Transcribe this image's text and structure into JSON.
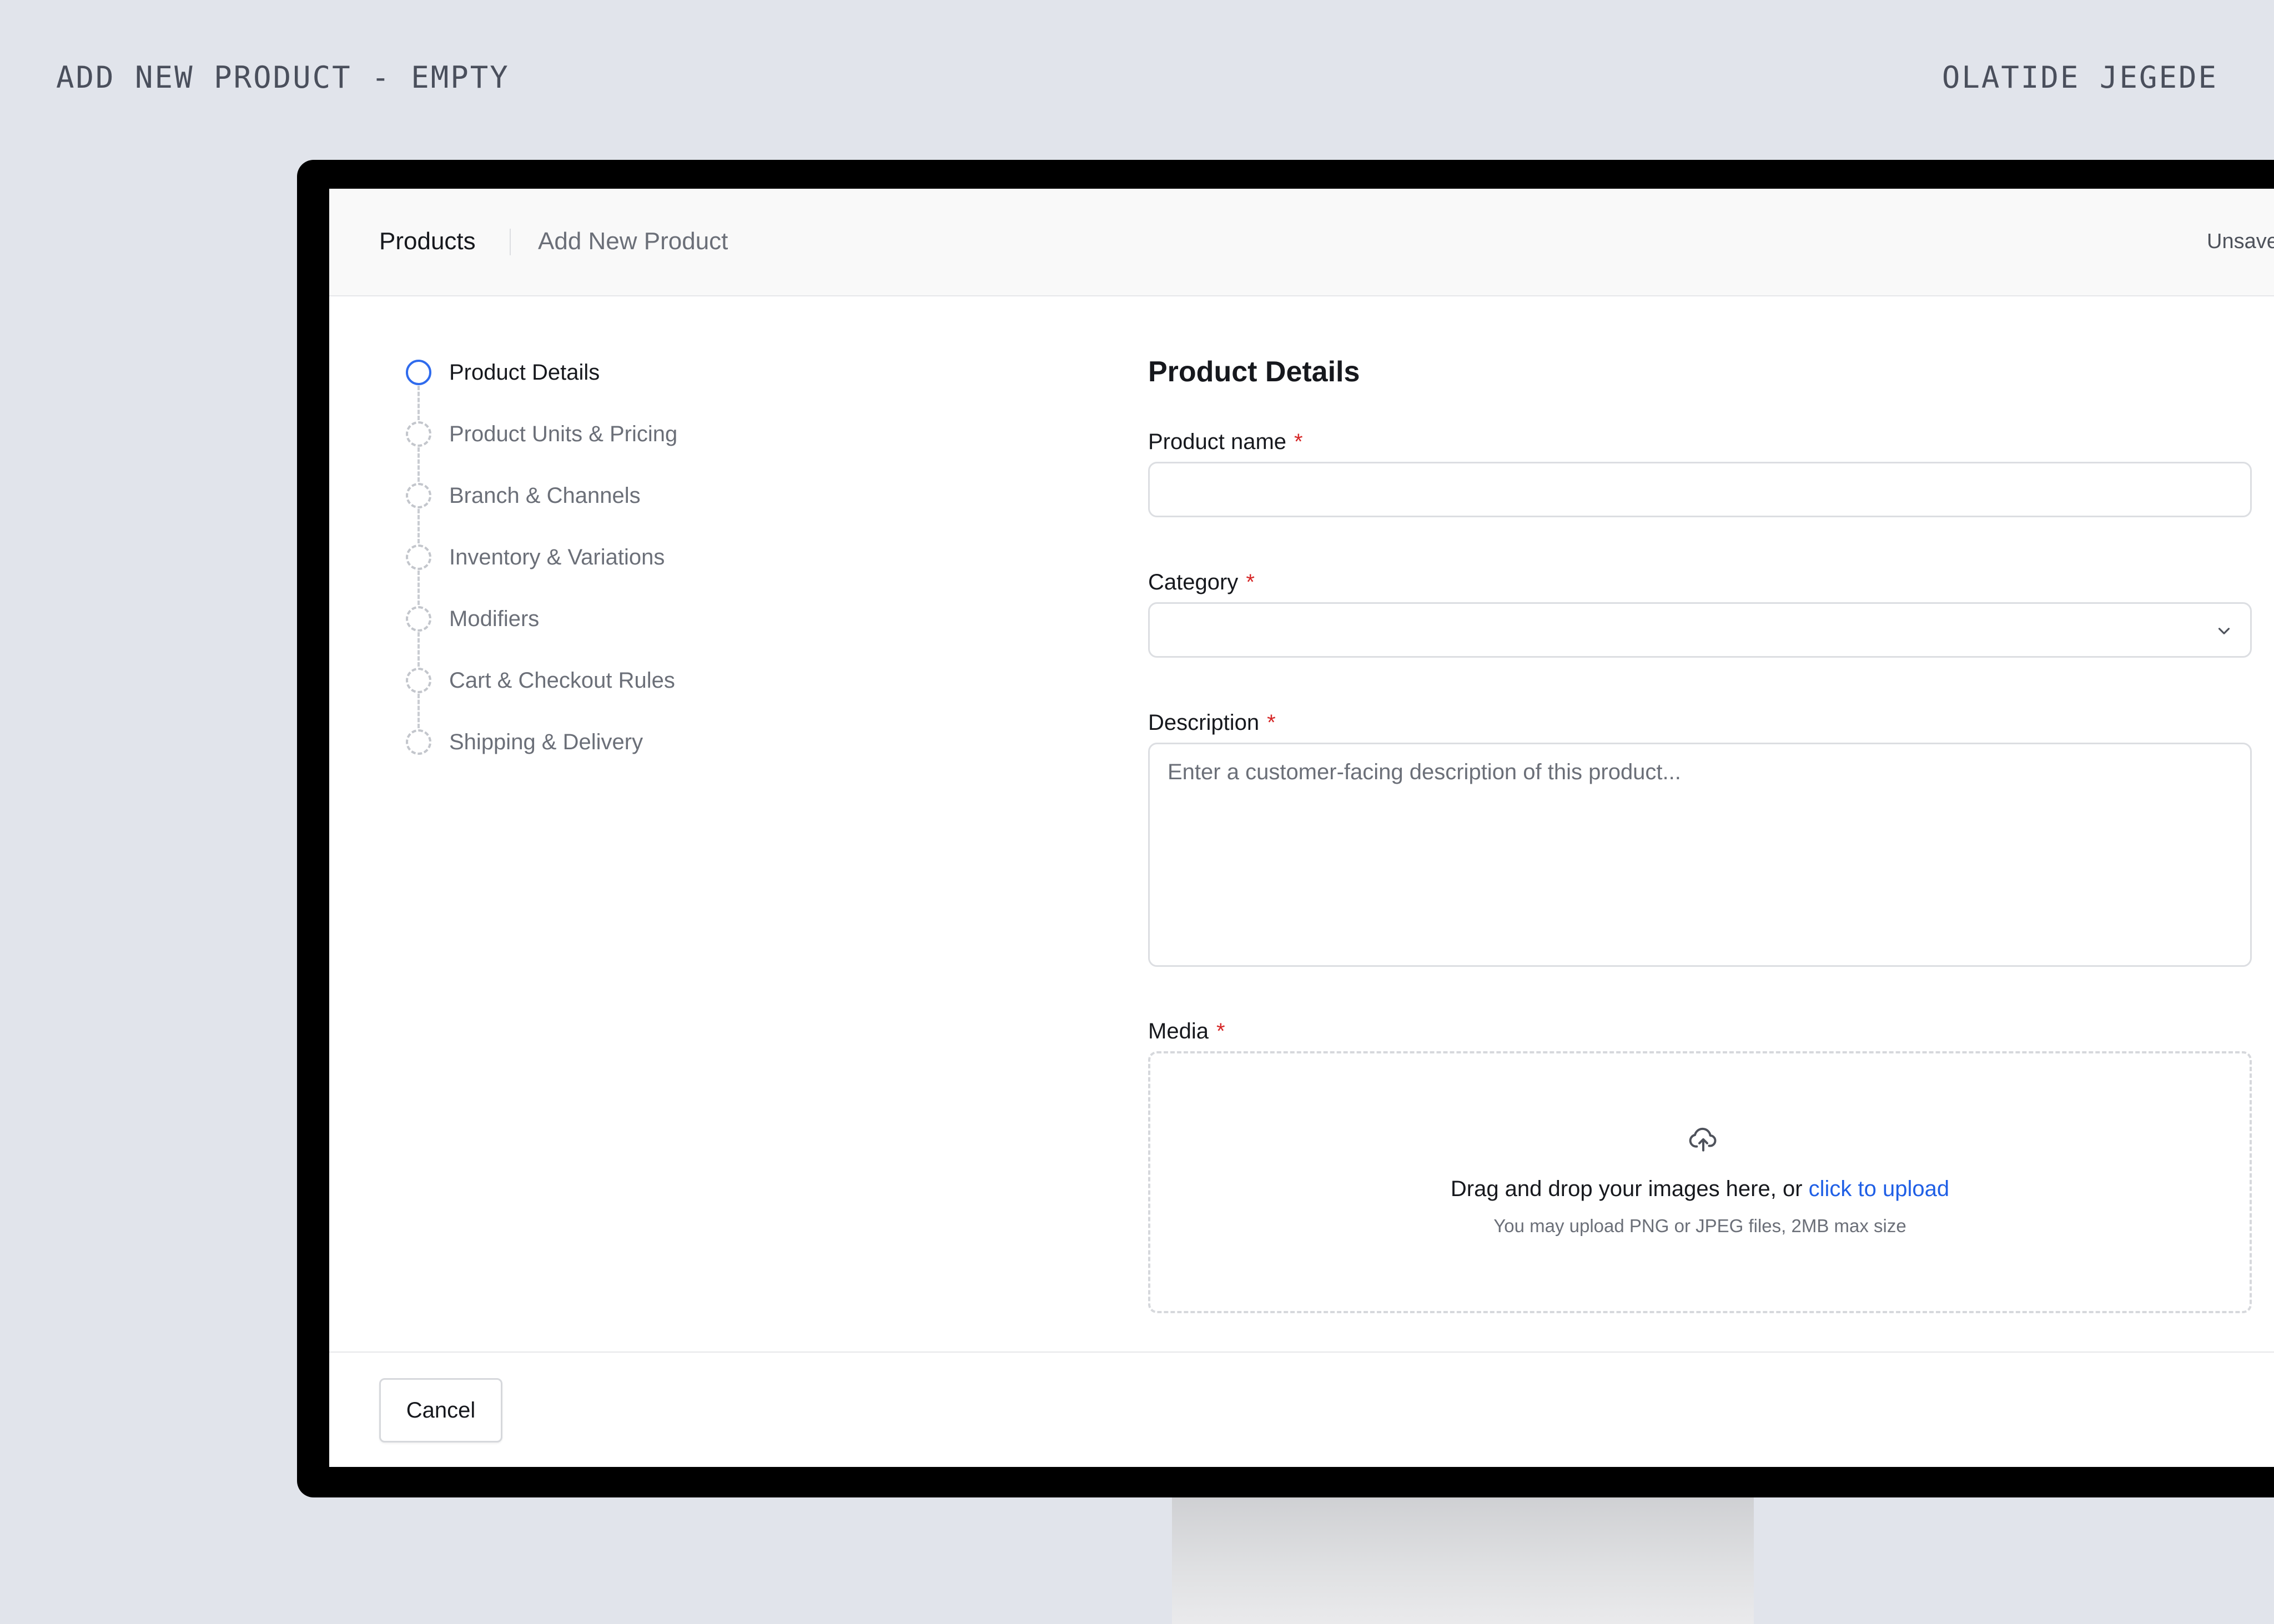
{
  "captions": {
    "left": "ADD NEW PRODUCT - EMPTY",
    "right": "OLATIDE JEGEDE"
  },
  "header": {
    "breadcrumb_root": "Products",
    "breadcrumb_current": "Add New Product",
    "status": "Unsave"
  },
  "steps": [
    {
      "label": "Product Details",
      "active": true
    },
    {
      "label": "Product Units & Pricing",
      "active": false
    },
    {
      "label": "Branch & Channels",
      "active": false
    },
    {
      "label": "Inventory & Variations",
      "active": false
    },
    {
      "label": "Modifiers",
      "active": false
    },
    {
      "label": "Cart & Checkout Rules",
      "active": false
    },
    {
      "label": "Shipping & Delivery",
      "active": false
    }
  ],
  "form": {
    "title": "Product Details",
    "required_marker": "*",
    "product_name": {
      "label": "Product name",
      "value": ""
    },
    "category": {
      "label": "Category",
      "value": ""
    },
    "description": {
      "label": "Description",
      "placeholder": "Enter a customer-facing description of this product...",
      "value": ""
    },
    "media": {
      "label": "Media",
      "drop_text": "Drag and drop your images here, or",
      "upload_link": "click to upload",
      "hint": "You may upload PNG or JPEG files, 2MB max size"
    }
  },
  "footer": {
    "cancel_label": "Cancel"
  },
  "colors": {
    "accent": "#2f6bed",
    "link": "#1f5fe6",
    "required": "#d62828",
    "background": "#e1e4eb"
  },
  "icons": {
    "upload": "cloud-upload-icon",
    "select": "chevron-down-icon",
    "step_active": "circle-active-icon",
    "step_pending": "circle-dashed-icon"
  }
}
